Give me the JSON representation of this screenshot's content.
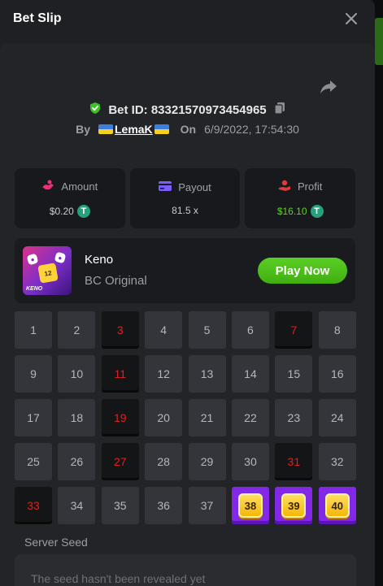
{
  "modal": {
    "title": "Bet Slip"
  },
  "bet": {
    "id_label": "Bet ID: 83321570973454965",
    "by_label": "By",
    "username": "LemaK",
    "on_label": "On",
    "date": "6/9/2022, 17:54:30"
  },
  "stats": {
    "amount": {
      "label": "Amount",
      "value": "$0.20",
      "icon": "amount-icon",
      "color": "#e8337a"
    },
    "payout": {
      "label": "Payout",
      "value": "81.5 x",
      "icon": "card-icon",
      "color": "#7a5cff"
    },
    "profit": {
      "label": "Profit",
      "value": "$16.10",
      "icon": "profit-icon",
      "color": "#e03a3a"
    }
  },
  "game": {
    "name": "Keno",
    "subtitle": "BC Original",
    "play_label": "Play Now",
    "thumb_brand": "KENO",
    "thumb_number": "12"
  },
  "grid": {
    "selected_numbers": [
      3,
      7,
      11,
      19,
      27,
      31,
      33
    ],
    "hit_numbers": [
      38,
      39,
      40
    ],
    "total": 40
  },
  "seed": {
    "label": "Server Seed",
    "value": "The seed hasn't been revealed yet"
  },
  "colors": {
    "accent_green": "#5bcf25",
    "selected_red": "#e02020",
    "hit_purple": "#8428e8",
    "gem_yellow": "#f4b400"
  }
}
